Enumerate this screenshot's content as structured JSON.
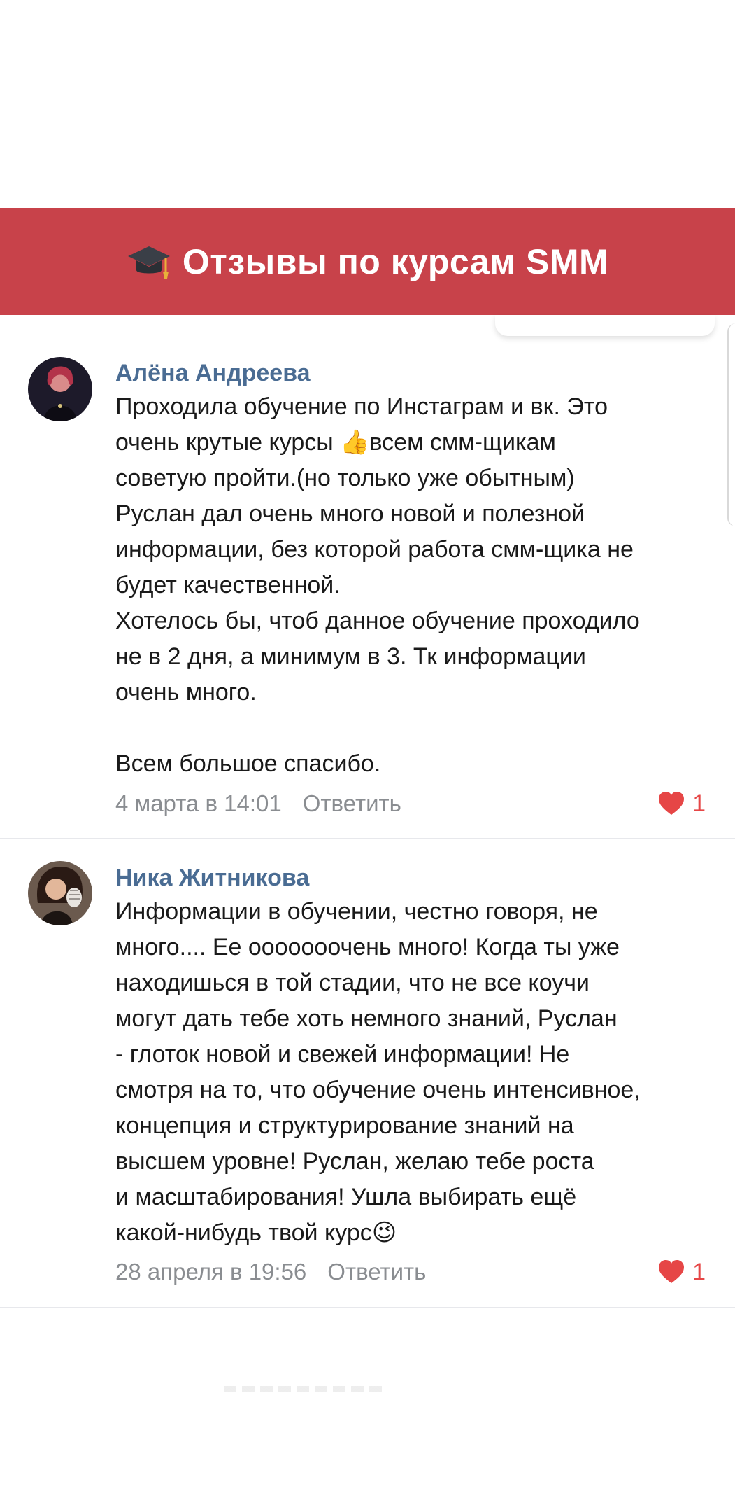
{
  "banner": {
    "title": "Отзывы по курсам SMM",
    "icon": "graduation-cap-icon",
    "color": "#c8424a"
  },
  "comments": [
    {
      "author": "Алёна Андреева",
      "text": "Проходила обучение по Инстаграм и вк. Это\nочень крутые курсы 👍всем смм-щикам\nсоветую пройти.(но только уже обытным)\nРуслан дал очень много новой и полезной\nинформации, без которой работа смм-щика не\nбудет качественной.\nХотелось бы, чтоб данное обучение проходило\nне в 2 дня, а минимум в 3. Тк информации\nочень много.\n\nВсем большое спасибо.",
      "date": "4 марта в 14:01",
      "reply_label": "Ответить",
      "likes": "1"
    },
    {
      "author": "Ника Житникова",
      "text": "Информации в обучении, честно говоря, не\nмного.... Ее ооооооочень много! Когда ты уже\nнаходишься в той стадии, что не все коучи\nмогут дать тебе хоть немного знаний, Руслан\n- глоток новой и свежей информации! Не\nсмотря на то, что обучение очень интенсивное,\nконцепция и структурирование знаний на\nвысшем уровне! Руслан, желаю тебе роста\nи масштабирования! Ушла выбирать ещё\nкакой-нибудь твой курс😉",
      "date": "28 апреля в 19:56",
      "reply_label": "Ответить",
      "likes": "1"
    }
  ],
  "colors": {
    "author": "#4a6c93",
    "meta": "#8a8d91",
    "like": "#e64646"
  }
}
